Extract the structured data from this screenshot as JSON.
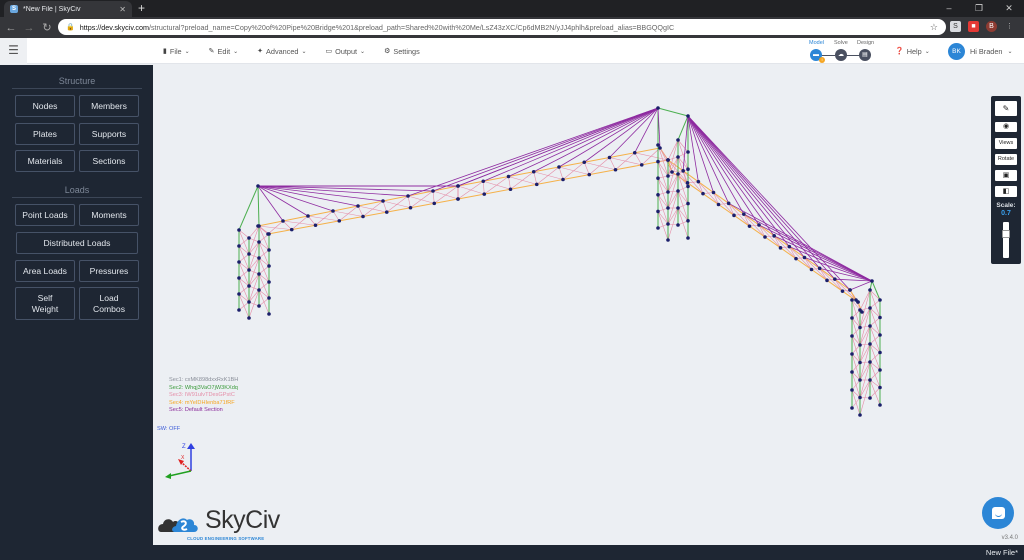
{
  "browser": {
    "tab_title": "*New File | SkyCiv",
    "tab_favicon": "S",
    "new_tab_symbol": "+",
    "window_controls": [
      "–",
      "❐",
      "✕"
    ],
    "url_host": "https://dev.skyciv.com",
    "url_path": "/structural?preload_name=Copy%20of%20Pipe%20Bridge%201&preload_path=Shared%20with%20Me/LsZ43zXC/Cp6dMB2N/yJJ4phlh&preload_alias=BBGQQgIC",
    "nav_icons": [
      "arrow-left-icon",
      "arrow-right-icon",
      "reload-icon"
    ],
    "extensions": [
      {
        "label": "S",
        "bg": "#dadce0"
      },
      {
        "label": "▣",
        "bg": "#e53935"
      },
      {
        "label": "B",
        "bg": "#8d3b32"
      }
    ],
    "menu_dots": "⋮"
  },
  "header": {
    "menu": [
      {
        "icon": "file-icon",
        "glyph": "▮",
        "label": "File",
        "has_dropdown": true
      },
      {
        "icon": "pencil-icon",
        "glyph": "✎",
        "label": "Edit",
        "has_dropdown": true
      },
      {
        "icon": "wrench-icon",
        "glyph": "🔧",
        "label": "Advanced",
        "has_dropdown": true
      },
      {
        "icon": "monitor-icon",
        "glyph": "▭",
        "label": "Output",
        "has_dropdown": true
      },
      {
        "icon": "gear-icon",
        "glyph": "⚙",
        "label": "Settings",
        "has_dropdown": false
      }
    ],
    "workflow": {
      "steps": [
        {
          "label": "Model",
          "active": true,
          "color": "#2c86d6"
        },
        {
          "label": "Solve",
          "active": false
        },
        {
          "label": "Design",
          "active": false
        }
      ],
      "warning_color": "#f5a623"
    },
    "help_label": "Help",
    "user": {
      "initials": "BK",
      "greeting": "Hi Braden"
    }
  },
  "sidebar": {
    "sections": [
      {
        "title": "Structure",
        "buttons": [
          "Nodes",
          "Members",
          "Plates",
          "Supports",
          "Materials",
          "Sections"
        ]
      },
      {
        "title": "Loads",
        "buttons": [
          "Point Loads",
          "Moments",
          "Distributed Loads",
          "Area Loads",
          "Pressures",
          "Self\nWeight",
          "Load\nCombos"
        ]
      }
    ]
  },
  "canvas": {
    "legend": [
      {
        "label": "Sec1: cxMK898dxxRxK1BH",
        "color": "#8a8f99"
      },
      {
        "label": "Sec2: Whqj3VaO7jW3KXdq",
        "color": "#3a9a3a"
      },
      {
        "label": "Sec3: IW91ulvTDesGPstC",
        "color": "#e58ea8"
      },
      {
        "label": "Sec4: mYeIDHIenba71fRF",
        "color": "#f5a623"
      },
      {
        "label": "Sec5: Default Section",
        "color": "#8a2b9a"
      }
    ],
    "self_weight": "SW: OFF",
    "axes": {
      "z": "Z",
      "x": "X",
      "y": ""
    },
    "logo": {
      "word": "SkyCiv",
      "tagline": "CLOUD ENGINEERING SOFTWARE"
    },
    "version": "v3.4.0",
    "colors": {
      "node": "#1b1f6b",
      "sec2": "#4caf50",
      "sec3": "#e58ea8",
      "sec4": "#f5b14a",
      "sec5": "#8e2ba0"
    }
  },
  "right_toolbar": {
    "buttons": [
      {
        "icon": "pencil-icon",
        "glyph": "✎",
        "label": ""
      },
      {
        "icon": "eye-icon",
        "glyph": "◉",
        "label": ""
      },
      {
        "icon": "",
        "glyph": "",
        "label": "Views"
      },
      {
        "icon": "",
        "glyph": "",
        "label": "Rotate"
      },
      {
        "icon": "camera-icon",
        "glyph": "▣",
        "label": ""
      },
      {
        "icon": "cube-icon",
        "glyph": "◧",
        "label": ""
      }
    ],
    "scale_label": "Scale:",
    "scale_value": "0.7",
    "scale_fraction": 0.7
  },
  "footer": {
    "file_name": "New File*"
  }
}
